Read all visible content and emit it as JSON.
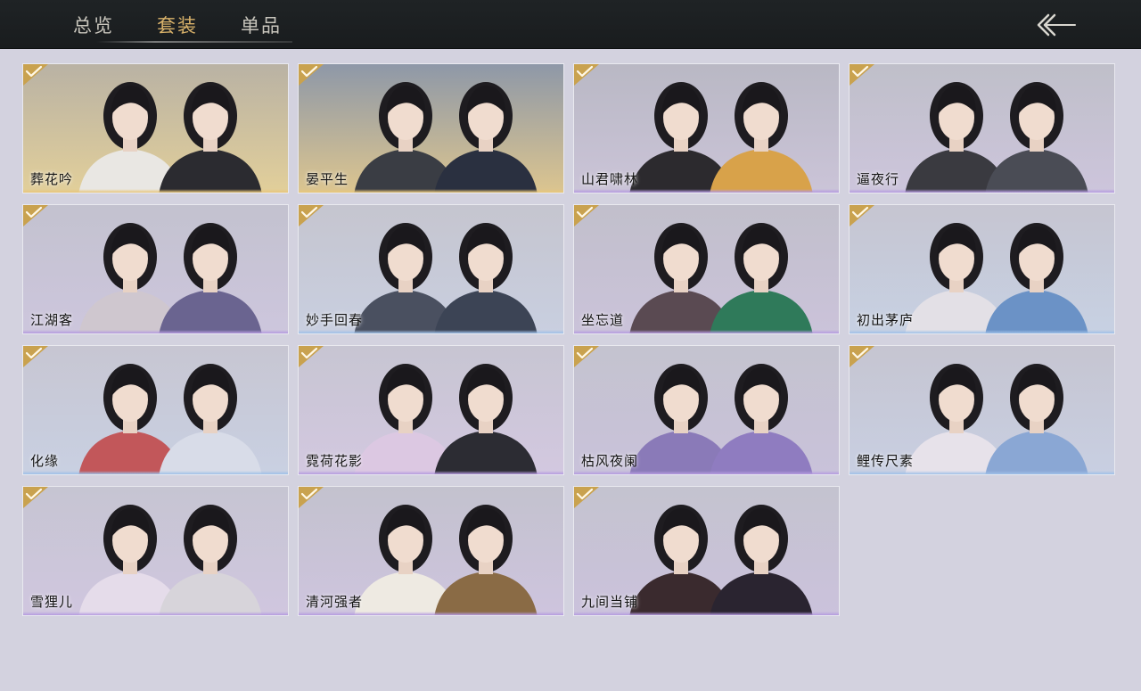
{
  "tabs": [
    {
      "label": "总览",
      "active": false
    },
    {
      "label": "套装",
      "active": true
    },
    {
      "label": "单品",
      "active": false
    }
  ],
  "back_icon": "back-arrow-icon",
  "colors": {
    "accent": "#d9b26a",
    "topbar": "#1c1f21",
    "background": "#d3d2df",
    "rarity_gold": "#e8c67a",
    "rarity_purple": "#b59be0",
    "rarity_blue": "#9ec0e8"
  },
  "outfits": [
    {
      "name": "葬花吟",
      "owned": true,
      "rarity": "gold",
      "bg": [
        "#b9b2a4",
        "#e2cf9a"
      ],
      "left": "#e9e7e3",
      "right": "#2b2b30"
    },
    {
      "name": "晏平生",
      "owned": true,
      "rarity": "gold",
      "bg": [
        "#8e98a8",
        "#dcc58f"
      ],
      "left": "#3a3d44",
      "right": "#2a3040"
    },
    {
      "name": "山君啸林",
      "owned": true,
      "rarity": "purple",
      "bg": [
        "#b9b8c4",
        "#cbc4d8"
      ],
      "left": "#2c2a2e",
      "right": "#d8a24a"
    },
    {
      "name": "逼夜行",
      "owned": true,
      "rarity": "purple",
      "bg": [
        "#bfbfc9",
        "#cdc5dc"
      ],
      "left": "#3a3a40",
      "right": "#4a4c55"
    },
    {
      "name": "江湖客",
      "owned": true,
      "rarity": "purple",
      "bg": [
        "#c3c2cf",
        "#cdc6dd"
      ],
      "left": "#cfc7cf",
      "right": "#6a6490"
    },
    {
      "name": "妙手回春",
      "owned": true,
      "rarity": "blue",
      "bg": [
        "#c5c5cf",
        "#c9cfe0"
      ],
      "left": "#4a5060",
      "right": "#3c4455"
    },
    {
      "name": "坐忘道",
      "owned": true,
      "rarity": "purple",
      "bg": [
        "#c1bfcb",
        "#cbc3da"
      ],
      "left": "#5a4a52",
      "right": "#2f7a5a"
    },
    {
      "name": "初出茅庐",
      "owned": true,
      "rarity": "blue",
      "bg": [
        "#c6c5d1",
        "#c7d1e3"
      ],
      "left": "#e3e0e6",
      "right": "#6b92c6"
    },
    {
      "name": "化缘",
      "owned": true,
      "rarity": "blue",
      "bg": [
        "#c7c6d2",
        "#c9d0e2"
      ],
      "left": "#c2575a",
      "right": "#d8dce8"
    },
    {
      "name": "霓荷花影",
      "owned": true,
      "rarity": "purple",
      "bg": [
        "#c7c5d2",
        "#d3c8e0"
      ],
      "left": "#dcc8e2",
      "right": "#2c2c33"
    },
    {
      "name": "枯风夜阑",
      "owned": true,
      "rarity": "purple",
      "bg": [
        "#c4c3cf",
        "#c9c2da"
      ],
      "left": "#8a7ab8",
      "right": "#8f7cc0"
    },
    {
      "name": "鲤传尺素",
      "owned": true,
      "rarity": "blue",
      "bg": [
        "#c6c5d1",
        "#c8cfe2"
      ],
      "left": "#e7e2ea",
      "right": "#8aa7d4"
    },
    {
      "name": "雪狸儿",
      "owned": true,
      "rarity": "purple",
      "bg": [
        "#c6c5d2",
        "#d0c6df"
      ],
      "left": "#e5dcea",
      "right": "#d7d4da"
    },
    {
      "name": "清河强者",
      "owned": true,
      "rarity": "purple",
      "bg": [
        "#c3c2ce",
        "#cec4de"
      ],
      "left": "#eeeae2",
      "right": "#8a6b45"
    },
    {
      "name": "九间当铺",
      "owned": true,
      "rarity": "purple",
      "bg": [
        "#c4c3cf",
        "#cbc2dc"
      ],
      "left": "#3a2a2e",
      "right": "#2a2430"
    }
  ]
}
